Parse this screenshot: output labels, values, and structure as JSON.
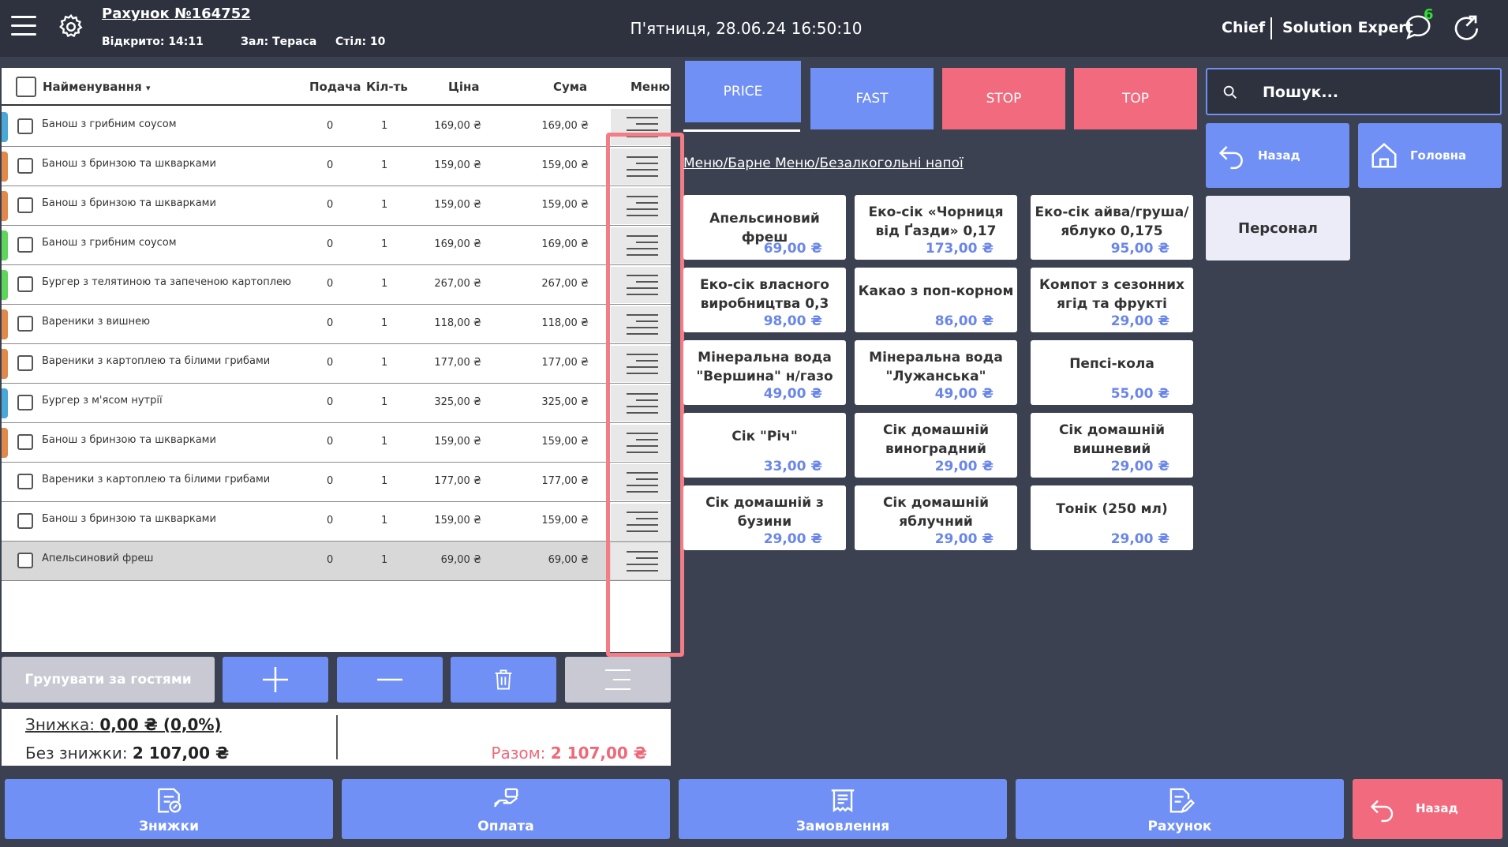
{
  "header": {
    "account_title": "Рахунок №164752",
    "opened": "Відкрито: 14:11",
    "hall": "Зал: Тераса",
    "table": "Стіл: 10",
    "datetime": "П'ятниця, 28.06.24 16:50:10",
    "role": "Chief",
    "user": "Solution Expert",
    "chat_badge": "6"
  },
  "order_table": {
    "columns": {
      "name": "Найменування",
      "serve": "Подача",
      "qty": "Кіл-ть",
      "price": "Ціна",
      "sum": "Сума",
      "menu": "Меню"
    },
    "sort_indicator": "▾",
    "rows": [
      {
        "name": "Банош з грибним соусом",
        "serve": "0",
        "qty": "1",
        "price": "169,00 ₴",
        "sum": "169,00 ₴",
        "color": "#4aa8d8"
      },
      {
        "name": "Банош з бринзою та шкварками",
        "serve": "0",
        "qty": "1",
        "price": "159,00 ₴",
        "sum": "159,00 ₴",
        "color": "#e0894a"
      },
      {
        "name": "Банош з бринзою та шкварками",
        "serve": "0",
        "qty": "1",
        "price": "159,00 ₴",
        "sum": "159,00 ₴",
        "color": "#e0894a"
      },
      {
        "name": "Банош з грибним соусом",
        "serve": "0",
        "qty": "1",
        "price": "169,00 ₴",
        "sum": "169,00 ₴",
        "color": "#5ed65a"
      },
      {
        "name": "Бургер з телятиною та запеченою картоплею",
        "serve": "0",
        "qty": "1",
        "price": "267,00 ₴",
        "sum": "267,00 ₴",
        "color": "#5ed65a"
      },
      {
        "name": "Вареники з вишнею",
        "serve": "0",
        "qty": "1",
        "price": "118,00 ₴",
        "sum": "118,00 ₴",
        "color": "#e0894a"
      },
      {
        "name": "Вареники з картоплею та білими грибами",
        "serve": "0",
        "qty": "1",
        "price": "177,00 ₴",
        "sum": "177,00 ₴",
        "color": "#e0894a"
      },
      {
        "name": "Бургер з м'ясом нутрії",
        "serve": "0",
        "qty": "1",
        "price": "325,00 ₴",
        "sum": "325,00 ₴",
        "color": "#4aa8d8"
      },
      {
        "name": "Банош з бринзою та шкварками",
        "serve": "0",
        "qty": "1",
        "price": "159,00 ₴",
        "sum": "159,00 ₴",
        "color": "#e0894a"
      },
      {
        "name": "Вареники з картоплею та білими грибами",
        "serve": "0",
        "qty": "1",
        "price": "177,00 ₴",
        "sum": "177,00 ₴",
        "color": ""
      },
      {
        "name": "Банош з бринзою та шкварками",
        "serve": "0",
        "qty": "1",
        "price": "159,00 ₴",
        "sum": "159,00 ₴",
        "color": ""
      },
      {
        "name": "Апельсиновий фреш",
        "serve": "0",
        "qty": "1",
        "price": "69,00 ₴",
        "sum": "69,00 ₴",
        "color": "",
        "selected": true
      }
    ]
  },
  "actions": {
    "group_by_guests": "Групувати за гостями"
  },
  "totals": {
    "discount_label": "Знижка:",
    "discount_value": "0,00 ₴ (0,0%)",
    "no_discount_label": "Без знижки:",
    "no_discount_value": "2 107,00 ₴",
    "total_label": "Разом:",
    "total_value": "2 107,00 ₴"
  },
  "tabs": [
    {
      "label": "PRICE",
      "color": "#7090f5",
      "active": true
    },
    {
      "label": "FAST",
      "color": "#7090f5"
    },
    {
      "label": "STOP",
      "color": "#f26a7d"
    },
    {
      "label": "TOP",
      "color": "#f26a7d"
    }
  ],
  "breadcrumb": "Меню/Барне Меню/Безалкогольні напої",
  "products": [
    {
      "name": "Апельсиновий фреш",
      "price": "69,00 ₴"
    },
    {
      "name": "Еко-сік «Чорниця від Ґазди» 0,17",
      "price": "173,00 ₴"
    },
    {
      "name": "Еко-сік айва/груша/ яблуко 0,175",
      "price": "95,00 ₴"
    },
    {
      "name": "Еко-сік власного виробництва 0,3",
      "price": "98,00 ₴"
    },
    {
      "name": "Какао з поп-корном",
      "price": "86,00 ₴"
    },
    {
      "name": "Компот з сезонних ягід та фрукті",
      "price": "29,00 ₴"
    },
    {
      "name": "Мінеральна вода \"Вершина\" н/газо",
      "price": "49,00 ₴"
    },
    {
      "name": "Мінеральна вода \"Лужанська\"",
      "price": "49,00 ₴"
    },
    {
      "name": "Пепсі-кола",
      "price": "55,00 ₴"
    },
    {
      "name": "Сік \"Річ\"",
      "price": "33,00 ₴"
    },
    {
      "name": "Сік домашній виноградний",
      "price": "29,00 ₴"
    },
    {
      "name": "Сік домашній вишневий",
      "price": "29,00 ₴"
    },
    {
      "name": "Сік домашній з бузини",
      "price": "29,00 ₴"
    },
    {
      "name": "Сік домашній яблучний",
      "price": "29,00 ₴"
    },
    {
      "name": "Тонік (250 мл)",
      "price": "29,00 ₴"
    }
  ],
  "search": {
    "placeholder": "Пошук..."
  },
  "nav": {
    "back": "Назад",
    "home": "Головна",
    "staff": "Персонал"
  },
  "bottom": {
    "discounts": "Знижки",
    "payment": "Оплата",
    "order": "Замовлення",
    "bill": "Рахунок",
    "back": "Назад"
  },
  "colors": {
    "accent": "#7090f5",
    "danger": "#f26a7d",
    "header_bg": "#2d323e",
    "body_bg": "#3b4150",
    "highlight": "#f47c86"
  },
  "icons": {
    "menu": "hamburger-icon",
    "settings": "gear-icon",
    "chat": "chat-bubble-icon",
    "exit": "exit-arrow-icon",
    "search": "search-icon",
    "back": "back-arrow-icon",
    "home": "home-icon",
    "plus": "plus-icon",
    "minus": "minus-icon",
    "trash": "trash-icon",
    "lines": "lines-icon"
  }
}
